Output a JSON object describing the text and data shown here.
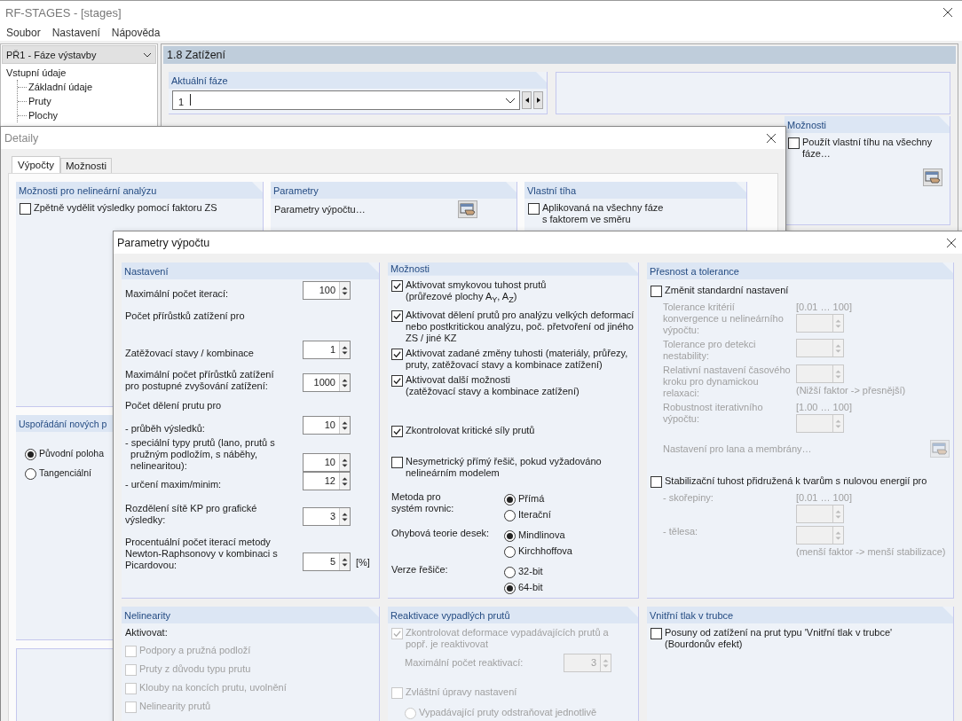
{
  "main_window": {
    "title": "RF-STAGES - [stages]"
  },
  "menu": [
    "Soubor",
    "Nastavení",
    "Nápověda"
  ],
  "navigator": {
    "dropdown": "PŘ1 - Fáze výstavby",
    "tree": [
      {
        "label": "Vstupní údaje",
        "children": [
          {
            "label": "Základní údaje"
          },
          {
            "label": "Pruty"
          },
          {
            "label": "Plochy"
          }
        ]
      }
    ]
  },
  "page": {
    "title": "1.8 Zatížení",
    "current_phase": {
      "title": "Aktuální fáze",
      "value": "1"
    },
    "options": {
      "title": "Možnosti",
      "checkbox": {
        "label": "Použít vlastní tíhu na všechny\nfáze…",
        "checked": false
      }
    }
  },
  "details_dialog": {
    "title": "Detaily",
    "tabs": [
      {
        "label": "Výpočty",
        "selected": true
      },
      {
        "label": "Možnosti",
        "selected": false
      }
    ],
    "nonlinear": {
      "title": "Možnosti pro nelineární analýzu",
      "checkbox": {
        "label": "Zpětně vydělit výsledky pomocí faktoru ZS",
        "checked": false
      }
    },
    "parameters": {
      "title": "Parametry",
      "label": "Parametry výpočtu…"
    },
    "self_weight": {
      "title": "Vlastní tíha",
      "checkbox": {
        "label": "Aplikovaná na všechny fáze\ns faktorem ve směru",
        "checked": false
      }
    },
    "arrangement": {
      "title": "Uspořádání nových p",
      "radios": [
        {
          "label": "Původní poloha",
          "selected": true
        },
        {
          "label": "Tangenciální",
          "selected": false
        }
      ]
    }
  },
  "params_dialog": {
    "title": "Parametry výpočtu",
    "settings": {
      "title": "Nastavení",
      "rows": [
        {
          "kind": "spin",
          "label": "Maximální počet iterací:",
          "value": "100"
        },
        {
          "kind": "heading",
          "label": "Počet přírůstků zatížení pro"
        },
        {
          "kind": "spin",
          "label": "Zatěžovací stavy / kombinace",
          "value": "1"
        },
        {
          "kind": "spin",
          "label": "Maximální počet přírůstků zatížení\npro postupné zvyšování zatížení:",
          "value": "1000"
        },
        {
          "kind": "heading",
          "label": "Počet dělení prutu pro"
        },
        {
          "kind": "spin",
          "label": "- průběh výsledků:",
          "value": "10"
        },
        {
          "kind": "spin",
          "label": "- speciální typy prutů (lano, prutů s\n  pružným podložím, s náběhy,\n  nelinearitou):",
          "value": "10"
        },
        {
          "kind": "spin",
          "label": "- určení maxim/minim:",
          "value": "12"
        },
        {
          "kind": "spin",
          "label": "Rozdělení sítě KP pro grafické\nvýsledky:",
          "value": "3"
        },
        {
          "kind": "spin",
          "label": "Procentuální počet iterací metody\nNewton-Raphsonovy v kombinaci s\nPicardovou:",
          "value": "5",
          "unit": "[%]"
        }
      ]
    },
    "nonlinearities": {
      "title": "Nelinearity",
      "label": "Aktivovat:",
      "items": [
        {
          "label": "Podpory a pružná podloží",
          "checked": false,
          "disabled": true
        },
        {
          "label": "Pruty z důvodu typu prutu",
          "checked": false,
          "disabled": true
        },
        {
          "label": "Klouby na koncích prutu, uvolnění",
          "checked": false,
          "disabled": true
        },
        {
          "label": "Nelinearity prutů",
          "checked": false,
          "disabled": true
        }
      ]
    },
    "options": {
      "title": "Možnosti",
      "checks": [
        {
          "label": "Aktivovat smykovou tuhost prutů\n(průřezové plochy A$_{Y}$, A$_{Z}$)",
          "checked": true
        },
        {
          "label": "Aktivovat dělení prutů pro analýzu velkých deformací\nnebo postkritickou analýzu, poč. přetvoření od jiného\nZS / jiné KZ",
          "checked": true
        },
        {
          "label": "Aktivovat zadané změny tuhosti (materiály, průřezy,\npruty, zatěžovací stavy a kombinace zatížení)",
          "checked": true
        },
        {
          "label": "Aktivovat další možnosti\n(zatěžovací stavy a kombinace zatížení)",
          "checked": true
        },
        {
          "label": "Zkontrolovat kritické síly prutů",
          "checked": true
        },
        {
          "label": "Nesymetrický přímý řešič, pokud vyžadováno\nnelineárním modelem",
          "checked": false
        }
      ],
      "radio_groups": [
        {
          "label": "Metoda pro\nsystém rovnic:",
          "options": [
            {
              "label": "Přímá",
              "selected": true
            },
            {
              "label": "Iterační",
              "selected": false
            }
          ]
        },
        {
          "label": "Ohybová teorie desek:",
          "options": [
            {
              "label": "Mindlinova",
              "selected": true
            },
            {
              "label": "Kirchhoffova",
              "selected": false
            }
          ]
        },
        {
          "label": "Verze řešiče:",
          "options": [
            {
              "label": "32-bit",
              "selected": false
            },
            {
              "label": "64-bit",
              "selected": true
            }
          ]
        }
      ]
    },
    "reactivation": {
      "title": "Reaktivace vypadlých prutů",
      "check": {
        "label": "Zkontrolovat deformace vypadávajících prutů a\npopř. je reaktivovat",
        "checked": true,
        "disabled": true
      },
      "spin": {
        "label": "Maximální počet reaktivací:",
        "value": "3",
        "disabled": true
      },
      "check2": {
        "label": "Zvláštní úpravy nastavení",
        "checked": false,
        "disabled": true
      },
      "radio": {
        "label": "Vypadávající pruty odstraňovat jednotlivě",
        "selected": false,
        "disabled": true
      }
    },
    "precision": {
      "title": "Přesnost a tolerance",
      "rows": [
        {
          "kind": "check",
          "label": "Změnit standardní nastavení",
          "checked": false
        },
        {
          "kind": "spin",
          "label": "Tolerance kritérií\nkonvergence u nelineárního\nvýpočtu:",
          "range": "[0.01 … 100]",
          "disabled": true
        },
        {
          "kind": "spin",
          "label": "Tolerance pro detekci\nnestability:",
          "disabled": true
        },
        {
          "kind": "spin",
          "label": "Relativní nastavení časového\nkroku pro dynamickou\nrelaxaci:",
          "note": "(Nižší faktor -> přesnější)",
          "disabled": true
        },
        {
          "kind": "spin",
          "label": "Robustnost iterativního\nvýpočtu:",
          "range": "[1.00 … 100]",
          "disabled": true
        },
        {
          "kind": "button",
          "label": "Nastavení pro lana a membrány…",
          "disabled": true
        },
        {
          "kind": "check",
          "label": "Stabilizační tuhost přidružená k tvarům s nulovou energií pro",
          "checked": false
        },
        {
          "kind": "spin",
          "label": "- skořepiny:",
          "range": "[0.01 … 100]",
          "disabled": true
        },
        {
          "kind": "spin",
          "label": "- tělesa:",
          "note": "(menší faktor -> menší stabilizace)",
          "disabled": true
        }
      ]
    },
    "pipe_pressure": {
      "title": "Vnitřní tlak v trubce",
      "check": {
        "label": "Posuny od zatížení na prut typu 'Vnitřní tlak v trubce'\n(Bourdonův efekt)",
        "checked": false
      }
    }
  }
}
